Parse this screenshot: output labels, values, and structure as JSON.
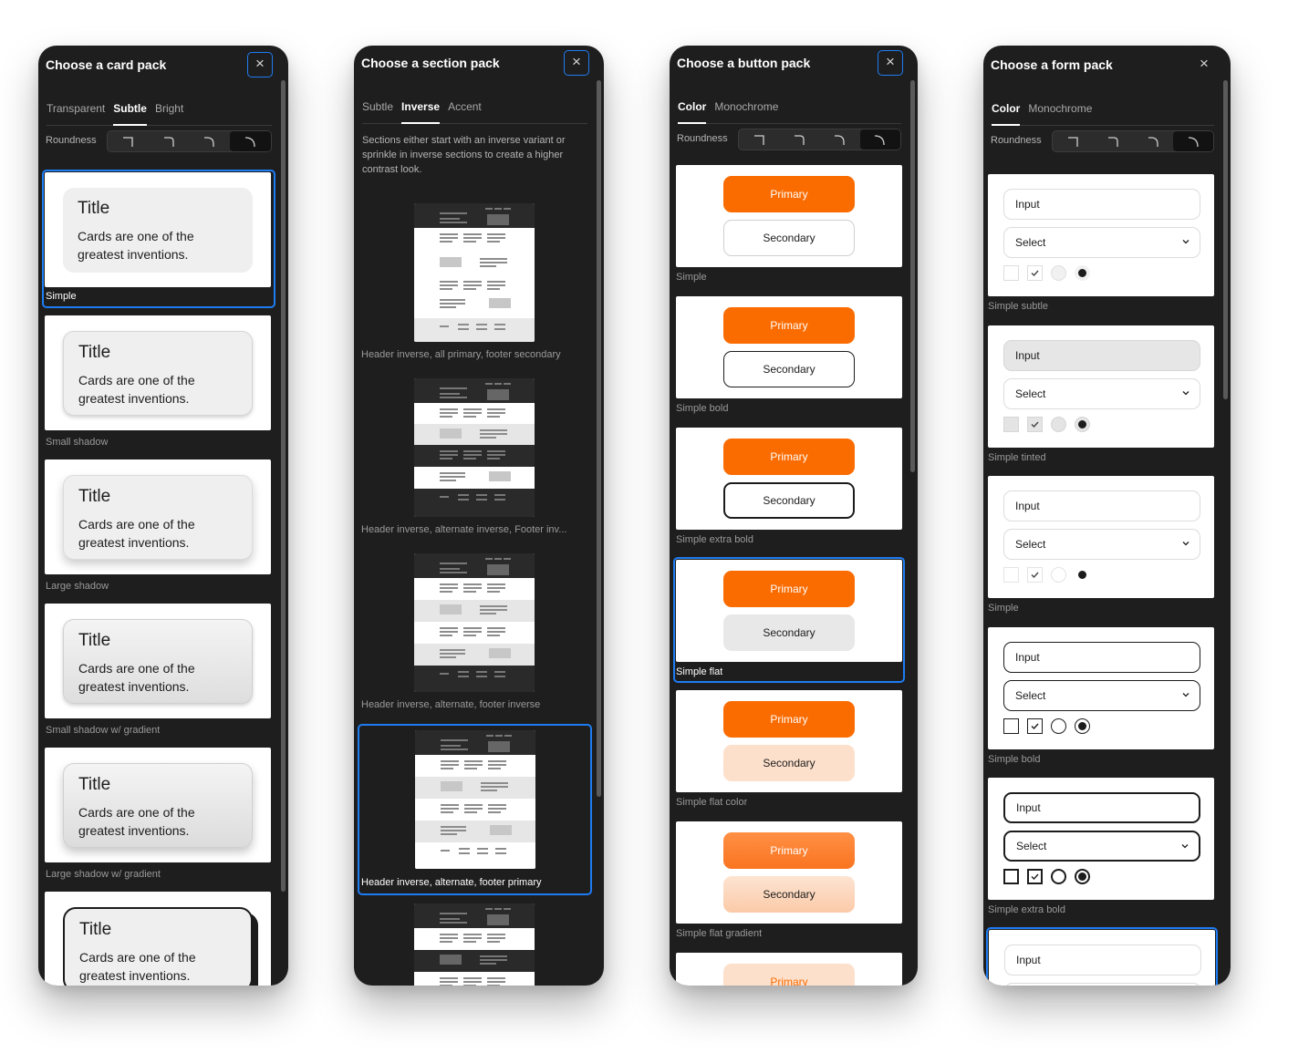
{
  "colors": {
    "panel_bg": "#1e1e1e",
    "accent_blue": "#1e7cf2",
    "primary_orange": "#fa6b00",
    "text_white": "#ffffff",
    "text_muted": "#a9a9a9"
  },
  "icons": {
    "close": "close-icon",
    "chevron": "chevron-down-icon",
    "corner": "corner-radius-icon"
  },
  "card_pack": {
    "title": "Choose a card pack",
    "close": "×",
    "tabs": [
      "Transparent",
      "Subtle",
      "Bright"
    ],
    "active_tab": "Subtle",
    "roundness_label": "Roundness",
    "active_roundness": 4,
    "card_title": "Title",
    "card_body": "Cards are one of the greatest inventions.",
    "items": [
      {
        "label": "Simple",
        "selected": true
      },
      {
        "label": "Small shadow"
      },
      {
        "label": "Large shadow"
      },
      {
        "label": "Small shadow w/ gradient"
      },
      {
        "label": "Large shadow w/ gradient"
      },
      {
        "label": ""
      }
    ]
  },
  "section_pack": {
    "title": "Choose a section pack",
    "close": "×",
    "tabs": [
      "Subtle",
      "Inverse",
      "Accent"
    ],
    "active_tab": "Inverse",
    "description": "Sections either start with an inverse variant or sprinkle in inverse sections to create a higher contrast look.",
    "items": [
      {
        "label": "Header inverse, all primary, footer secondary"
      },
      {
        "label": "Header inverse, alternate inverse, Footer inv..."
      },
      {
        "label": "Header inverse, alternate, footer inverse"
      },
      {
        "label": "Header inverse, alternate, footer primary",
        "selected": true
      },
      {
        "label": ""
      }
    ]
  },
  "button_pack": {
    "title": "Choose a button pack",
    "close": "×",
    "tabs": [
      "Color",
      "Monochrome"
    ],
    "active_tab": "Color",
    "roundness_label": "Roundness",
    "active_roundness": 4,
    "primary_label": "Primary",
    "secondary_label": "Secondary",
    "items": [
      {
        "label": "Simple"
      },
      {
        "label": "Simple bold"
      },
      {
        "label": "Simple extra bold"
      },
      {
        "label": "Simple flat",
        "selected": true
      },
      {
        "label": "Simple flat color"
      },
      {
        "label": "Simple flat gradient"
      },
      {
        "label": ""
      }
    ]
  },
  "form_pack": {
    "title": "Choose a form pack",
    "close": "×",
    "tabs": [
      "Color",
      "Monochrome"
    ],
    "active_tab": "Color",
    "roundness_label": "Roundness",
    "active_roundness": 4,
    "input_label": "Input",
    "select_label": "Select",
    "items": [
      {
        "label": "Simple subtle"
      },
      {
        "label": "Simple tinted"
      },
      {
        "label": "Simple"
      },
      {
        "label": "Simple bold"
      },
      {
        "label": "Simple extra bold"
      },
      {
        "label": "",
        "selected": true
      }
    ]
  }
}
